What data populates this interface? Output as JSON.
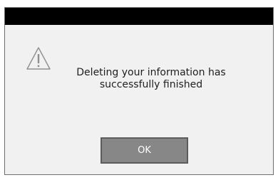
{
  "dialog": {
    "title": "",
    "icon": "warning-triangle-icon",
    "message_line1": "Deleting your information has",
    "message_line2": "successfully finished",
    "ok_label": "OK"
  },
  "colors": {
    "title_bar": "#000000",
    "dialog_background": "#f1f1f1",
    "button_background": "#878787",
    "button_text": "#ffffff"
  }
}
